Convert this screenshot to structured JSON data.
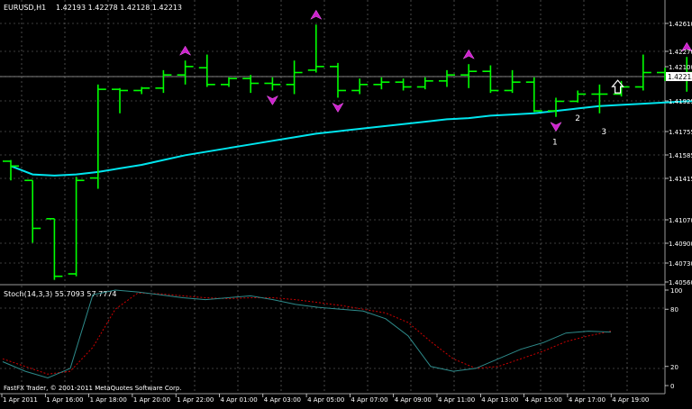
{
  "header": {
    "symbol_timeframe": "EURUSD,H1",
    "ohlc": "1.42193 1.42278 1.42128 1.42213"
  },
  "indicator": {
    "label": "Stoch(14,3,3) 55.7093 57.7774"
  },
  "footer": {
    "copyright": "FastFX Trader, © 2001-2011 MetaQuotes Software Corp."
  },
  "price_axis": {
    "labels": [
      "1.42610",
      "1.42270",
      "1.42100",
      "1.41925",
      "1.41755",
      "1.41585",
      "1.41415",
      "1.41070",
      "1.40900",
      "1.40730",
      "1.40560"
    ],
    "current_price_label": "1.42213"
  },
  "stoch_axis": {
    "labels": [
      "100",
      "80",
      "20",
      "0"
    ]
  },
  "time_axis": {
    "labels": [
      "1 Apr 2011",
      "1 Apr 16:00",
      "1 Apr 18:00",
      "1 Apr 20:00",
      "1 Apr 22:00",
      "4 Apr 01:00",
      "4 Apr 03:00",
      "4 Apr 05:00",
      "4 Apr 07:00",
      "4 Apr 09:00",
      "4 Apr 11:00",
      "4 Apr 13:00",
      "4 Apr 15:00",
      "4 Apr 17:00",
      "4 Apr 19:00"
    ]
  },
  "markers": {
    "labels": [
      "1",
      "2",
      "3"
    ]
  },
  "colors": {
    "background": "#000000",
    "candles": "#00ff00",
    "moving_average": "#00e5ee",
    "stoch_main": "#2e8b8b",
    "stoch_signal": "#cc0000",
    "fractal_arrows": "#cc22cc",
    "grid": "#7a7a7a",
    "text": "#ffffff"
  },
  "chart_data": {
    "type": "candlestick",
    "symbol": "EURUSD",
    "timeframe": "H1",
    "ylim": [
      1.4056,
      1.428
    ],
    "bars": [
      {
        "o": 1.4156,
        "h": 1.4157,
        "l": 1.414,
        "c": 1.4152
      },
      {
        "o": 1.414,
        "h": 1.414,
        "l": 1.4088,
        "c": 1.41
      },
      {
        "o": 1.4108,
        "h": 1.4108,
        "l": 1.4057,
        "c": 1.406
      },
      {
        "o": 1.4062,
        "h": 1.4143,
        "l": 1.406,
        "c": 1.414
      },
      {
        "o": 1.4142,
        "h": 1.422,
        "l": 1.4133,
        "c": 1.4216
      },
      {
        "o": 1.4216,
        "h": 1.4217,
        "l": 1.4196,
        "c": 1.4215
      },
      {
        "o": 1.4215,
        "h": 1.4218,
        "l": 1.4212,
        "c": 1.4217
      },
      {
        "o": 1.4217,
        "h": 1.4232,
        "l": 1.4213,
        "c": 1.4228
      },
      {
        "o": 1.4228,
        "h": 1.424,
        "l": 1.422,
        "c": 1.4235
      },
      {
        "o": 1.4234,
        "h": 1.4245,
        "l": 1.4218,
        "c": 1.422
      },
      {
        "o": 1.422,
        "h": 1.4226,
        "l": 1.4218,
        "c": 1.4225
      },
      {
        "o": 1.4225,
        "h": 1.4228,
        "l": 1.4213,
        "c": 1.4221
      },
      {
        "o": 1.4221,
        "h": 1.4226,
        "l": 1.4215,
        "c": 1.422
      },
      {
        "o": 1.422,
        "h": 1.424,
        "l": 1.4212,
        "c": 1.423
      },
      {
        "o": 1.4232,
        "h": 1.427,
        "l": 1.423,
        "c": 1.4235
      },
      {
        "o": 1.4235,
        "h": 1.4238,
        "l": 1.4209,
        "c": 1.4215
      },
      {
        "o": 1.4215,
        "h": 1.4225,
        "l": 1.4212,
        "c": 1.422
      },
      {
        "o": 1.422,
        "h": 1.4226,
        "l": 1.4216,
        "c": 1.4222
      },
      {
        "o": 1.4222,
        "h": 1.4225,
        "l": 1.4215,
        "c": 1.4218
      },
      {
        "o": 1.4218,
        "h": 1.4226,
        "l": 1.4216,
        "c": 1.4223
      },
      {
        "o": 1.4223,
        "h": 1.4232,
        "l": 1.4218,
        "c": 1.4228
      },
      {
        "o": 1.4228,
        "h": 1.4237,
        "l": 1.4217,
        "c": 1.4231
      },
      {
        "o": 1.4231,
        "h": 1.4236,
        "l": 1.4213,
        "c": 1.4215
      },
      {
        "o": 1.4215,
        "h": 1.4232,
        "l": 1.4213,
        "c": 1.4222
      },
      {
        "o": 1.4222,
        "h": 1.4226,
        "l": 1.4197,
        "c": 1.4198
      },
      {
        "o": 1.4198,
        "h": 1.4209,
        "l": 1.4193,
        "c": 1.4206
      },
      {
        "o": 1.4206,
        "h": 1.4215,
        "l": 1.4205,
        "c": 1.4212
      },
      {
        "o": 1.4212,
        "h": 1.422,
        "l": 1.4196,
        "c": 1.4212
      },
      {
        "o": 1.4212,
        "h": 1.4223,
        "l": 1.421,
        "c": 1.4218
      },
      {
        "o": 1.4218,
        "h": 1.4245,
        "l": 1.4215,
        "c": 1.423
      },
      {
        "o": 1.423,
        "h": 1.4234,
        "l": 1.4223,
        "c": 1.4228
      },
      {
        "o": 1.4228,
        "h": 1.4243,
        "l": 1.4214,
        "c": 1.423
      },
      {
        "o": 1.423,
        "h": 1.4232,
        "l": 1.4203,
        "c": 1.4218
      },
      {
        "o": 1.4218,
        "h": 1.4225,
        "l": 1.4215,
        "c": 1.4221
      }
    ],
    "moving_average": [
      1.4152,
      1.4145,
      1.4144,
      1.4145,
      1.4147,
      1.415,
      1.4153,
      1.4157,
      1.4161,
      1.4164,
      1.4167,
      1.417,
      1.4173,
      1.4176,
      1.4179,
      1.4181,
      1.4183,
      1.4185,
      1.4187,
      1.4189,
      1.4191,
      1.4192,
      1.4194,
      1.4195,
      1.4196,
      1.4198,
      1.42,
      1.4202,
      1.4203,
      1.4204,
      1.4205,
      1.4206,
      1.4206,
      1.4206
    ],
    "fractals_up": [
      8,
      14,
      21,
      31
    ],
    "fractals_down": [
      12,
      15,
      25
    ],
    "numbered_markers": [
      {
        "label": "1",
        "bar": 25
      },
      {
        "label": "2",
        "bar": 26
      },
      {
        "label": "3",
        "bar": 27
      }
    ],
    "arrow_marker_bar": 28,
    "stochastic": {
      "ylim": [
        0,
        100
      ],
      "main": [
        25,
        15,
        8,
        18,
        95,
        100,
        98,
        95,
        92,
        90,
        92,
        94,
        90,
        85,
        82,
        80,
        78,
        70,
        52,
        20,
        15,
        18,
        28,
        38,
        45,
        55,
        57,
        56
      ],
      "signal": [
        28,
        20,
        12,
        15,
        40,
        80,
        97,
        96,
        94,
        92,
        91,
        92,
        92,
        90,
        87,
        84,
        80,
        76,
        66,
        46,
        28,
        18,
        20,
        28,
        36,
        46,
        52,
        57
      ]
    }
  }
}
